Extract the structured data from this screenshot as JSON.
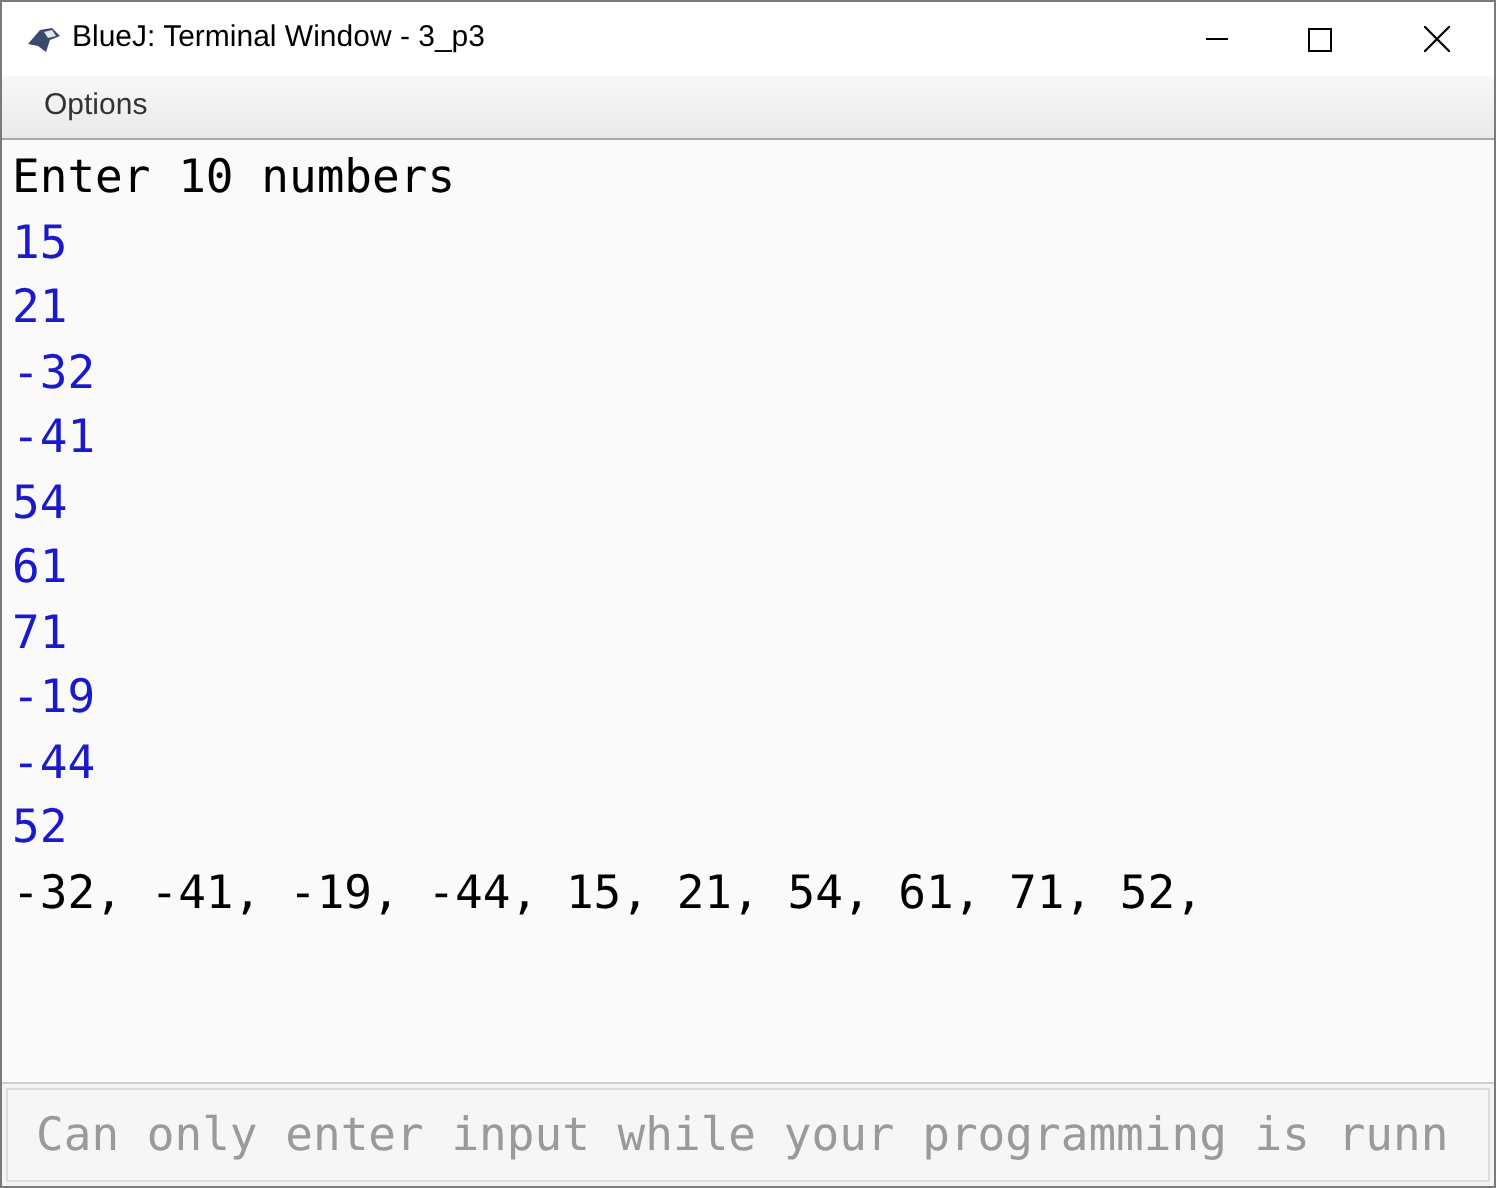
{
  "window": {
    "title": "BlueJ: Terminal Window - 3_p3"
  },
  "menu": [
    "Options"
  ],
  "terminal": {
    "lines": [
      {
        "text": "Enter 10 numbers",
        "kind": "output"
      },
      {
        "text": "15",
        "kind": "input"
      },
      {
        "text": "21",
        "kind": "input"
      },
      {
        "text": "-32",
        "kind": "input"
      },
      {
        "text": "-41",
        "kind": "input"
      },
      {
        "text": "54",
        "kind": "input"
      },
      {
        "text": "61",
        "kind": "input"
      },
      {
        "text": "71",
        "kind": "input"
      },
      {
        "text": "-19",
        "kind": "input"
      },
      {
        "text": "-44",
        "kind": "input"
      },
      {
        "text": "52",
        "kind": "input"
      },
      {
        "text": "-32, -41, -19, -44, 15, 21, 54, 61, 71, 52,",
        "kind": "output"
      }
    ]
  },
  "input": {
    "placeholder": "Can only enter input while your programming is runn",
    "disabled": true
  }
}
